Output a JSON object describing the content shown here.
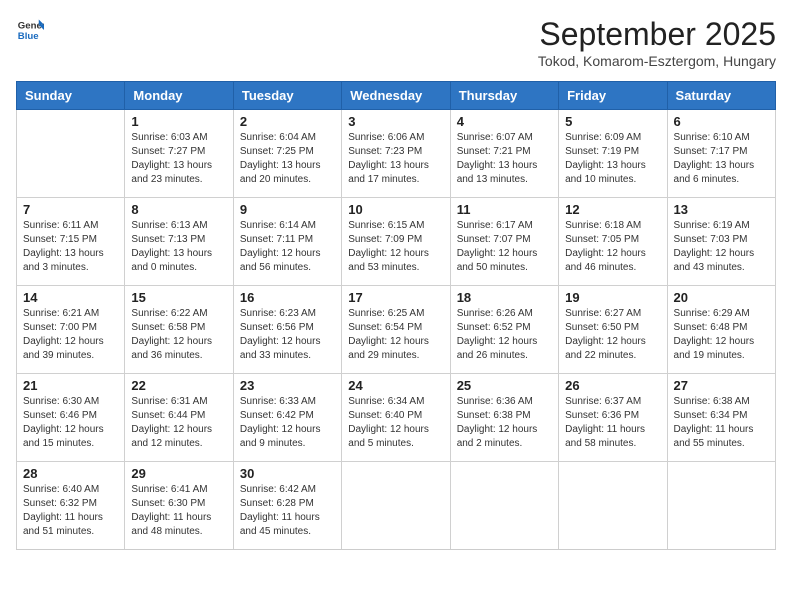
{
  "header": {
    "logo_general": "General",
    "logo_blue": "Blue",
    "month_title": "September 2025",
    "subtitle": "Tokod, Komarom-Esztergom, Hungary"
  },
  "weekdays": [
    "Sunday",
    "Monday",
    "Tuesday",
    "Wednesday",
    "Thursday",
    "Friday",
    "Saturday"
  ],
  "weeks": [
    [
      {
        "day": "",
        "info": ""
      },
      {
        "day": "1",
        "info": "Sunrise: 6:03 AM\nSunset: 7:27 PM\nDaylight: 13 hours\nand 23 minutes."
      },
      {
        "day": "2",
        "info": "Sunrise: 6:04 AM\nSunset: 7:25 PM\nDaylight: 13 hours\nand 20 minutes."
      },
      {
        "day": "3",
        "info": "Sunrise: 6:06 AM\nSunset: 7:23 PM\nDaylight: 13 hours\nand 17 minutes."
      },
      {
        "day": "4",
        "info": "Sunrise: 6:07 AM\nSunset: 7:21 PM\nDaylight: 13 hours\nand 13 minutes."
      },
      {
        "day": "5",
        "info": "Sunrise: 6:09 AM\nSunset: 7:19 PM\nDaylight: 13 hours\nand 10 minutes."
      },
      {
        "day": "6",
        "info": "Sunrise: 6:10 AM\nSunset: 7:17 PM\nDaylight: 13 hours\nand 6 minutes."
      }
    ],
    [
      {
        "day": "7",
        "info": "Sunrise: 6:11 AM\nSunset: 7:15 PM\nDaylight: 13 hours\nand 3 minutes."
      },
      {
        "day": "8",
        "info": "Sunrise: 6:13 AM\nSunset: 7:13 PM\nDaylight: 13 hours\nand 0 minutes."
      },
      {
        "day": "9",
        "info": "Sunrise: 6:14 AM\nSunset: 7:11 PM\nDaylight: 12 hours\nand 56 minutes."
      },
      {
        "day": "10",
        "info": "Sunrise: 6:15 AM\nSunset: 7:09 PM\nDaylight: 12 hours\nand 53 minutes."
      },
      {
        "day": "11",
        "info": "Sunrise: 6:17 AM\nSunset: 7:07 PM\nDaylight: 12 hours\nand 50 minutes."
      },
      {
        "day": "12",
        "info": "Sunrise: 6:18 AM\nSunset: 7:05 PM\nDaylight: 12 hours\nand 46 minutes."
      },
      {
        "day": "13",
        "info": "Sunrise: 6:19 AM\nSunset: 7:03 PM\nDaylight: 12 hours\nand 43 minutes."
      }
    ],
    [
      {
        "day": "14",
        "info": "Sunrise: 6:21 AM\nSunset: 7:00 PM\nDaylight: 12 hours\nand 39 minutes."
      },
      {
        "day": "15",
        "info": "Sunrise: 6:22 AM\nSunset: 6:58 PM\nDaylight: 12 hours\nand 36 minutes."
      },
      {
        "day": "16",
        "info": "Sunrise: 6:23 AM\nSunset: 6:56 PM\nDaylight: 12 hours\nand 33 minutes."
      },
      {
        "day": "17",
        "info": "Sunrise: 6:25 AM\nSunset: 6:54 PM\nDaylight: 12 hours\nand 29 minutes."
      },
      {
        "day": "18",
        "info": "Sunrise: 6:26 AM\nSunset: 6:52 PM\nDaylight: 12 hours\nand 26 minutes."
      },
      {
        "day": "19",
        "info": "Sunrise: 6:27 AM\nSunset: 6:50 PM\nDaylight: 12 hours\nand 22 minutes."
      },
      {
        "day": "20",
        "info": "Sunrise: 6:29 AM\nSunset: 6:48 PM\nDaylight: 12 hours\nand 19 minutes."
      }
    ],
    [
      {
        "day": "21",
        "info": "Sunrise: 6:30 AM\nSunset: 6:46 PM\nDaylight: 12 hours\nand 15 minutes."
      },
      {
        "day": "22",
        "info": "Sunrise: 6:31 AM\nSunset: 6:44 PM\nDaylight: 12 hours\nand 12 minutes."
      },
      {
        "day": "23",
        "info": "Sunrise: 6:33 AM\nSunset: 6:42 PM\nDaylight: 12 hours\nand 9 minutes."
      },
      {
        "day": "24",
        "info": "Sunrise: 6:34 AM\nSunset: 6:40 PM\nDaylight: 12 hours\nand 5 minutes."
      },
      {
        "day": "25",
        "info": "Sunrise: 6:36 AM\nSunset: 6:38 PM\nDaylight: 12 hours\nand 2 minutes."
      },
      {
        "day": "26",
        "info": "Sunrise: 6:37 AM\nSunset: 6:36 PM\nDaylight: 11 hours\nand 58 minutes."
      },
      {
        "day": "27",
        "info": "Sunrise: 6:38 AM\nSunset: 6:34 PM\nDaylight: 11 hours\nand 55 minutes."
      }
    ],
    [
      {
        "day": "28",
        "info": "Sunrise: 6:40 AM\nSunset: 6:32 PM\nDaylight: 11 hours\nand 51 minutes."
      },
      {
        "day": "29",
        "info": "Sunrise: 6:41 AM\nSunset: 6:30 PM\nDaylight: 11 hours\nand 48 minutes."
      },
      {
        "day": "30",
        "info": "Sunrise: 6:42 AM\nSunset: 6:28 PM\nDaylight: 11 hours\nand 45 minutes."
      },
      {
        "day": "",
        "info": ""
      },
      {
        "day": "",
        "info": ""
      },
      {
        "day": "",
        "info": ""
      },
      {
        "day": "",
        "info": ""
      }
    ]
  ]
}
